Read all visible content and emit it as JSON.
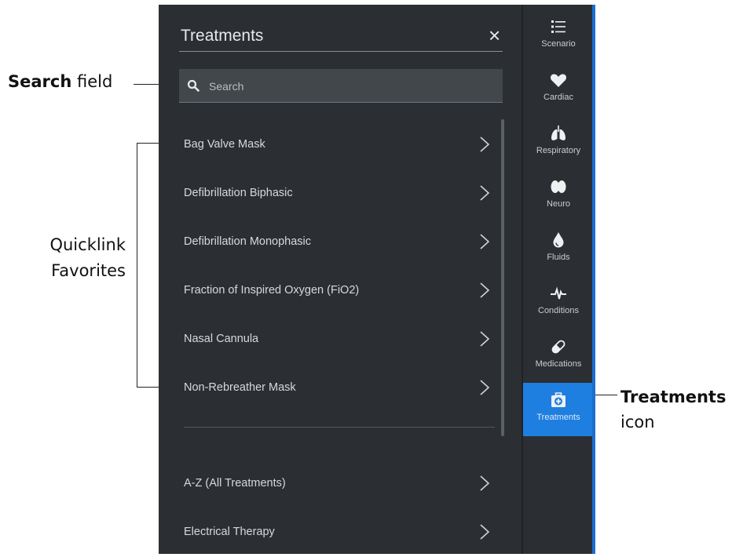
{
  "annotations": {
    "search_bold": "Search",
    "search_rest": " field",
    "quicklink_line1": "Quicklink",
    "quicklink_line2": "Favorites",
    "treatments_bold": "Treatments",
    "treatments_rest": "icon"
  },
  "panel": {
    "title": "Treatments",
    "close_glyph": "×",
    "search": {
      "placeholder": "Search",
      "value": ""
    },
    "favorites": [
      {
        "label": "Bag Valve Mask"
      },
      {
        "label": "Defibrillation Biphasic"
      },
      {
        "label": "Defibrillation Monophasic"
      },
      {
        "label": "Fraction of Inspired Oxygen (FiO2)"
      },
      {
        "label": "Nasal Cannula"
      },
      {
        "label": "Non-Rebreather Mask"
      }
    ],
    "categories": [
      {
        "label": "A-Z (All Treatments)"
      },
      {
        "label": "Electrical Therapy"
      }
    ]
  },
  "nav": {
    "items": [
      {
        "label": "Scenario",
        "icon": "list-icon"
      },
      {
        "label": "Cardiac",
        "icon": "heart-icon"
      },
      {
        "label": "Respiratory",
        "icon": "lungs-icon"
      },
      {
        "label": "Neuro",
        "icon": "brain-icon"
      },
      {
        "label": "Fluids",
        "icon": "droplet-icon"
      },
      {
        "label": "Conditions",
        "icon": "pulse-icon"
      },
      {
        "label": "Medications",
        "icon": "pill-icon"
      },
      {
        "label": "Treatments",
        "icon": "medkit-icon",
        "active": true
      }
    ],
    "active_color": "#1e7fe0"
  }
}
